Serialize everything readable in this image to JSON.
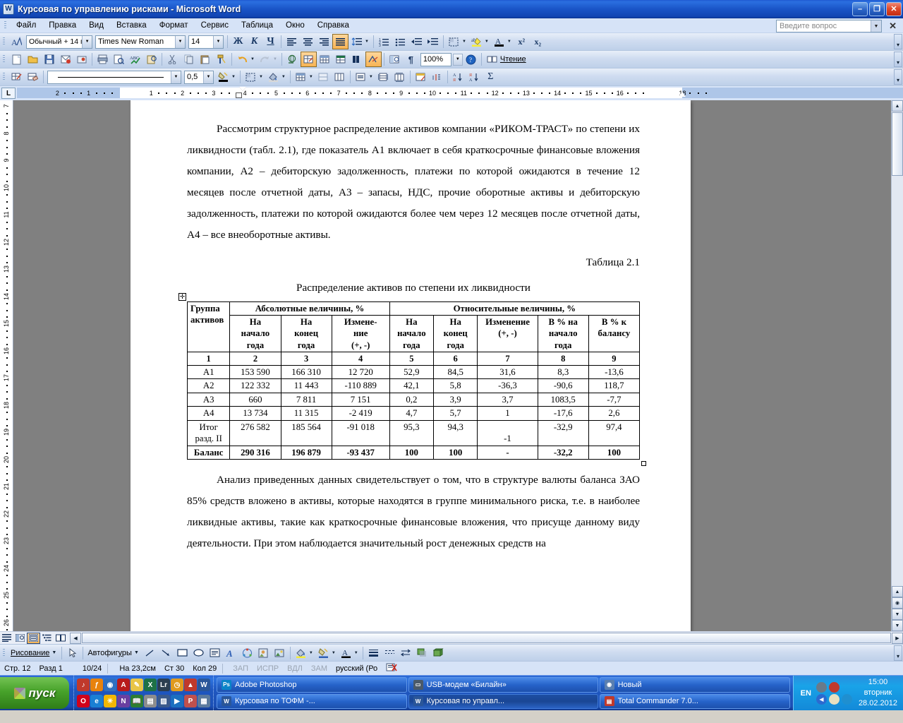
{
  "window": {
    "title": "Курсовая по управлению рисками - Microsoft Word",
    "app_icon": "word-document-icon",
    "minimize": "–",
    "restore": "❐",
    "close": "✕"
  },
  "menu": {
    "items": [
      {
        "label": "Файл"
      },
      {
        "label": "Правка"
      },
      {
        "label": "Вид"
      },
      {
        "label": "Вставка"
      },
      {
        "label": "Формат"
      },
      {
        "label": "Сервис"
      },
      {
        "label": "Таблица"
      },
      {
        "label": "Окно"
      },
      {
        "label": "Справка"
      }
    ],
    "ask_placeholder": "Введите вопрос"
  },
  "formatting_toolbar": {
    "style_value": "Обычный + 14 г",
    "font_value": "Times New Roman",
    "size_value": "14",
    "bold": "Ж",
    "italic": "К",
    "underline": "Ч",
    "align_left": "align-left-icon",
    "align_center": "align-center-icon",
    "align_right": "align-right-icon",
    "align_justify": "align-justify-icon",
    "line_spacing": "line-spacing-icon",
    "numbered_list": "numbered-list-icon",
    "bullet_list": "bullet-list-icon",
    "decrease_indent": "decrease-indent-icon",
    "increase_indent": "increase-indent-icon",
    "outside_border": "borders-icon",
    "highlight": "highlight-icon",
    "font_color": "font-color-icon",
    "superscript": "x²",
    "subscript": "x₂"
  },
  "standard_toolbar": {
    "new": "new-document-icon",
    "open": "open-folder-icon",
    "save": "save-icon",
    "mail": "email-icon",
    "permission": "permission-icon",
    "print": "print-icon",
    "preview": "print-preview-icon",
    "spelling": "spellcheck-icon",
    "research": "research-icon",
    "cut": "cut-icon",
    "copy": "copy-icon",
    "paste": "paste-icon",
    "format_painter": "format-painter-icon",
    "undo": "undo-icon",
    "redo": "redo-icon",
    "hyperlink": "hyperlink-icon",
    "tables_borders": "tables-and-borders-icon",
    "insert_table": "insert-table-icon",
    "insert_excel": "insert-excel-sheet-icon",
    "columns": "columns-icon",
    "drawing": "drawing-icon",
    "document_map": "document-map-icon",
    "show_marks": "¶",
    "zoom_value": "100%",
    "help": "help-icon",
    "reading_label": "Чтение",
    "reading_icon": "reading-layout-icon"
  },
  "tables_toolbar": {
    "draw_table": "draw-table-icon",
    "eraser": "eraser-icon",
    "line_style_value": "",
    "line_weight_value": "0,5",
    "border_color": "border-color-icon",
    "borders": "borders-dropdown-icon",
    "shading": "shading-color-icon",
    "insert_table": "insert-table-icon",
    "merge_cells": "merge-cells-icon",
    "split_cells": "split-cells-icon",
    "align": "cell-align-icon",
    "distribute_rows": "distribute-rows-evenly-icon",
    "distribute_cols": "distribute-columns-evenly-icon",
    "autoformat": "table-autoformat-icon",
    "change_direction": "change-text-direction-icon",
    "sort_asc": "sort-ascending-icon",
    "sort_desc": "sort-descending-icon",
    "autosum": "Σ"
  },
  "ruler": {
    "tab_selector": "L",
    "horizontal_ticks": [
      "2",
      "1",
      "1",
      "2",
      "3",
      "4",
      "5",
      "6",
      "7",
      "8",
      "9",
      "10",
      "11",
      "12",
      "13",
      "14",
      "15",
      "16",
      "18"
    ],
    "vertical_ticks": [
      "7",
      "8",
      "9",
      "10",
      "11",
      "12",
      "13",
      "14",
      "15",
      "16",
      "17",
      "18",
      "19",
      "20",
      "21",
      "22",
      "23",
      "24",
      "25"
    ]
  },
  "document": {
    "paragraph_1": "Рассмотрим структурное распределение активов компании «РИКОМ-ТРАСТ» по степени их ликвидности (табл. 2.1), где показатель А1 включает в себя краткосрочные финансовые вложения компании, А2 – дебиторскую задолженность, платежи по которой ожидаются в течение 12 месяцев после отчетной даты, А3 – запасы, НДС, прочие оборотные активы и дебиторскую задолженность, платежи по которой ожидаются более чем через 12 месяцев после отчетной даты, А4 – все внеоборотные активы.",
    "table_number": "Таблица 2.1",
    "table_caption": "Распределение активов по степени их ликвидности",
    "paragraph_2": "Анализ приведенных данных свидетельствует о том, что в структуре валюты баланса ЗАО 85% средств вложено в активы, которые находятся в группе минимального риска, т.е. в наиболее ликвидные активы, такие как краткосрочные финансовые вложения, что присуще данному виду деятельности. При этом наблюдается значительный рост денежных средств на"
  },
  "table_data": {
    "group_header": "Группа активов",
    "group_header_line1": "Группа",
    "group_header_line2": "активов",
    "abs_header": "Абсолютные величины, %",
    "rel_header": "Относительные величины, %",
    "subheaders": [
      "На начало года",
      "На конец года",
      "Измене-ние (+, -)",
      "На начало года",
      "На конец года",
      "Изменение (+, -)",
      "В % на начало года",
      "В % к балансу"
    ],
    "subheaders_lines": [
      [
        "На",
        "начало",
        "года"
      ],
      [
        "На",
        "конец",
        "года"
      ],
      [
        "Измене-",
        "ние",
        "(+, -)"
      ],
      [
        "На",
        "начало",
        "года"
      ],
      [
        "На",
        "конец",
        "года"
      ],
      [
        "Изменение",
        "(+, -)",
        ""
      ],
      [
        "В % на",
        "начало",
        "года"
      ],
      [
        "В % к",
        "балансу",
        ""
      ]
    ],
    "number_row": [
      "1",
      "2",
      "3",
      "4",
      "5",
      "6",
      "7",
      "8",
      "9"
    ],
    "rows": [
      {
        "label": "А1",
        "cells": [
          "153 590",
          "166 310",
          "12 720",
          "52,9",
          "84,5",
          "31,6",
          "8,3",
          "-13,6"
        ],
        "bold": false
      },
      {
        "label": "А2",
        "cells": [
          "122 332",
          "11 443",
          "-110 889",
          "42,1",
          "5,8",
          "-36,3",
          "-90,6",
          "118,7"
        ],
        "bold": false
      },
      {
        "label": "А3",
        "cells": [
          "660",
          "7 811",
          "7 151",
          "0,2",
          "3,9",
          "3,7",
          "1083,5",
          "-7,7"
        ],
        "bold": false
      },
      {
        "label": "А4",
        "cells": [
          "13 734",
          "11 315",
          "-2 419",
          "4,7",
          "5,7",
          "1",
          "-17,6",
          "2,6"
        ],
        "bold": false
      },
      {
        "label": "Итог разд. II",
        "cells": [
          "276 582",
          "185 564",
          "-91 018",
          "95,3",
          "94,3",
          "-1",
          "-32,9",
          "97,4"
        ],
        "bold": false
      },
      {
        "label": "Баланс",
        "cells": [
          "290 316",
          "196 879",
          "-93 437",
          "100",
          "100",
          "-",
          "-32,2",
          "100"
        ],
        "bold": true
      }
    ]
  },
  "view_bar": {
    "normal": "normal-view-icon",
    "web": "web-layout-view-icon",
    "print": "print-layout-view-icon",
    "outline": "outline-view-icon",
    "reading": "reading-layout-view-icon"
  },
  "drawing_toolbar": {
    "menu_label": "Рисование",
    "select_icon": "select-objects-icon",
    "autoshapes_label": "Автофигуры",
    "line": "line-icon",
    "arrow": "arrow-icon",
    "rectangle": "rectangle-icon",
    "oval": "oval-icon",
    "textbox": "text-box-icon",
    "wordart": "wordart-icon",
    "diagram": "diagram-icon",
    "clipart": "clip-art-icon",
    "picture": "insert-picture-icon",
    "fill_color": "fill-color-icon",
    "line_color": "line-color-icon",
    "font_color": "font-color-icon",
    "line_style": "line-style-icon",
    "dash_style": "dash-style-icon",
    "arrow_style": "arrow-style-icon",
    "shadow_style": "shadow-style-icon",
    "3d_style": "3d-style-icon"
  },
  "status_bar": {
    "page": "Стр. 12",
    "section": "Разд 1",
    "page_of": "10/24",
    "at": "На 23,2см",
    "line": "Ст 30",
    "column": "Кол 29",
    "rec": "ЗАП",
    "trk": "ИСПР",
    "ext": "ВДЛ",
    "ovr": "ЗАМ",
    "language": "русский (Ро",
    "spell_icon": "spelling-status-icon"
  },
  "taskbar": {
    "start_label": "пуск",
    "quick_launch": [
      {
        "name": "winamp-icon",
        "color": "#c0392b",
        "glyph": "♪"
      },
      {
        "name": "opera-icon",
        "color": "#d0021b",
        "glyph": "O"
      },
      {
        "name": "firefox-icon",
        "color": "#e8820c",
        "glyph": "ƒ"
      },
      {
        "name": "internet-explorer-icon",
        "color": "#1a7fd4",
        "glyph": "e"
      },
      {
        "name": "launch-icon",
        "color": "#2f6fc0",
        "glyph": "◉"
      },
      {
        "name": "nero-icon",
        "color": "#f2b705",
        "glyph": "☀"
      },
      {
        "name": "acrobat-icon",
        "color": "#b81b1b",
        "glyph": "A"
      },
      {
        "name": "onenote-icon",
        "color": "#6a3fa0",
        "glyph": "N"
      },
      {
        "name": "notepad-icon",
        "color": "#e8c547",
        "glyph": "✎"
      },
      {
        "name": "dictionary-icon",
        "color": "#2e7d32",
        "glyph": "📖"
      },
      {
        "name": "excel-icon",
        "color": "#1e7145",
        "glyph": "X"
      },
      {
        "name": "save-icon",
        "color": "#8d8d8d",
        "glyph": "▤"
      },
      {
        "name": "lightroom-icon",
        "color": "#2c3e50",
        "glyph": "Lr"
      },
      {
        "name": "winrar-icon",
        "color": "#3a5a8c",
        "glyph": "▨"
      },
      {
        "name": "clock-icon",
        "color": "#e09a1e",
        "glyph": "◷"
      },
      {
        "name": "media-player-icon",
        "color": "#1b6fc0",
        "glyph": "▶"
      },
      {
        "name": "mozilla-icon",
        "color": "#c0392b",
        "glyph": "▲"
      },
      {
        "name": "powerpoint-icon",
        "color": "#c0504d",
        "glyph": "P"
      },
      {
        "name": "word-icon",
        "color": "#2a5699",
        "glyph": "W"
      },
      {
        "name": "calculator-icon",
        "color": "#5b7a9d",
        "glyph": "▦"
      }
    ],
    "tasks": [
      {
        "label": "Adobe Photoshop",
        "icon": "photoshop-icon",
        "color": "#0a84c8",
        "glyph": "Ps",
        "active": false
      },
      {
        "label": "Курсовая по ТОФМ -...",
        "icon": "word-icon",
        "color": "#2a5699",
        "glyph": "W",
        "active": false
      },
      {
        "label": "USB-модем «Билайн»",
        "icon": "modem-icon",
        "color": "#4a5a6a",
        "glyph": "▭",
        "active": false
      },
      {
        "label": "Курсовая по управл...",
        "icon": "word-icon",
        "color": "#2a5699",
        "glyph": "W",
        "active": true
      },
      {
        "label": "Новый",
        "icon": "folder-icon",
        "color": "#5a7fb0",
        "glyph": "◉",
        "active": false
      },
      {
        "label": "Total Commander 7.0...",
        "icon": "total-commander-icon",
        "color": "#c0392b",
        "glyph": "▤",
        "active": false
      }
    ],
    "tray": {
      "language": "EN",
      "icons": [
        "network-icon",
        "volume-icon",
        "show-hidden-icon",
        "antivirus-icon",
        "app-icon"
      ],
      "time": "15:00",
      "weekday": "вторник",
      "date": "28.02.2012"
    }
  }
}
